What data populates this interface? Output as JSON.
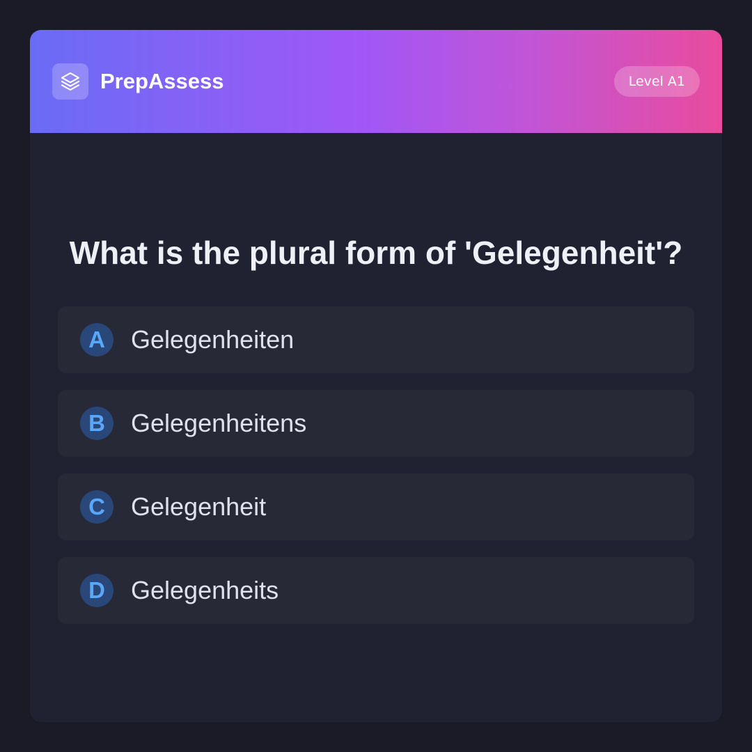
{
  "header": {
    "brand": "PrepAssess",
    "level": "Level A1",
    "logo_icon": "layers-icon",
    "gradient": [
      "#6a6cf6",
      "#a157f6",
      "#e94b9d"
    ]
  },
  "question": {
    "text": "What is the plural form of 'Gelegenheit'?"
  },
  "options": [
    {
      "letter": "A",
      "text": "Gelegenheiten"
    },
    {
      "letter": "B",
      "text": "Gelegenheitens"
    },
    {
      "letter": "C",
      "text": "Gelegenheit"
    },
    {
      "letter": "D",
      "text": "Gelegenheits"
    }
  ],
  "colors": {
    "background": "#1a1b26",
    "card": "#202231",
    "option_bg": "#272937",
    "letter_badge_bg": "#2a4779",
    "letter_color": "#5aa6f7"
  }
}
